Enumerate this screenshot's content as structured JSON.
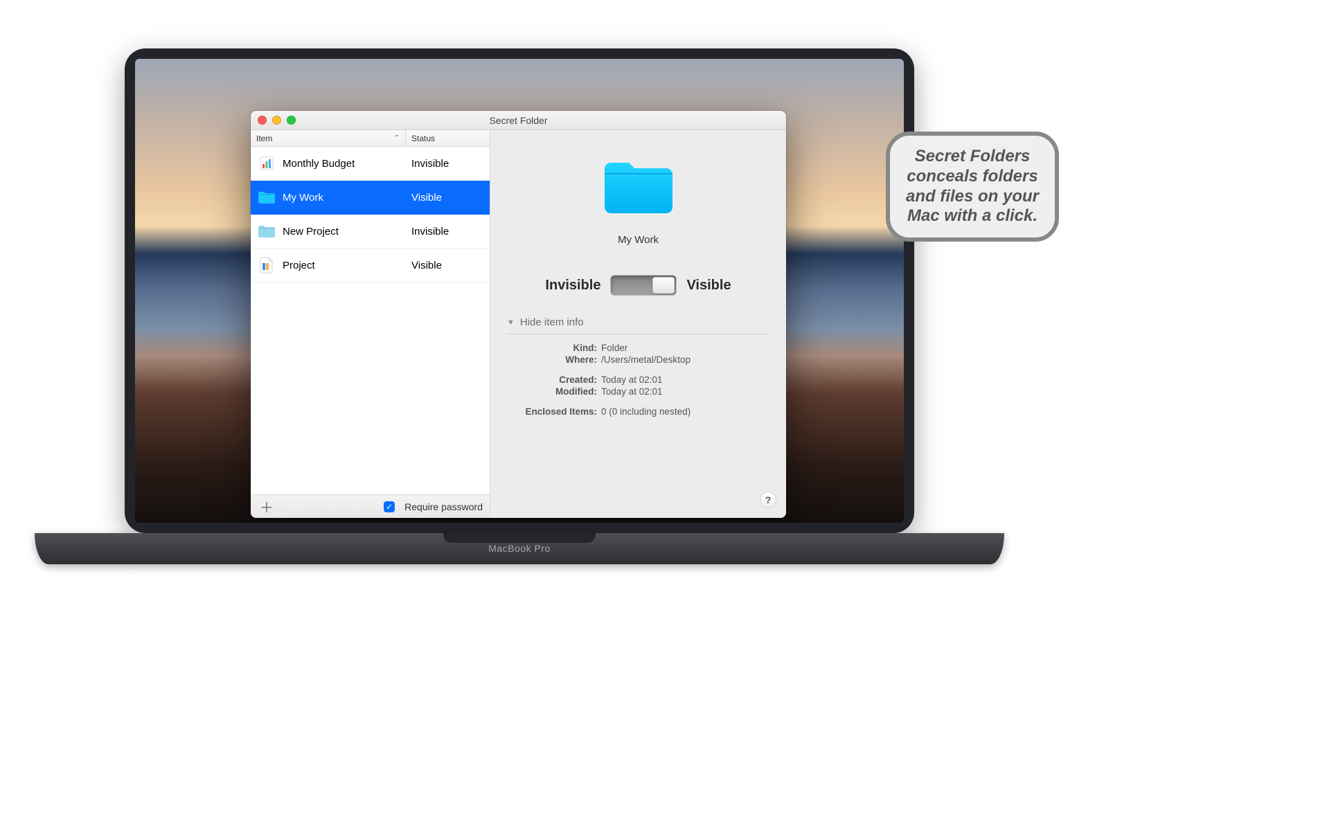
{
  "callout": {
    "text": "Secret Folders conceals folders and files on your Mac with a click."
  },
  "laptop": {
    "label": "MacBook Pro"
  },
  "window": {
    "title": "Secret Folder",
    "columns": {
      "item": "Item",
      "status": "Status"
    },
    "items": [
      {
        "icon": "chart",
        "name": "Monthly Budget",
        "status": "Invisible",
        "selected": false
      },
      {
        "icon": "folder",
        "name": "My Work",
        "status": "Visible",
        "selected": true
      },
      {
        "icon": "folder",
        "name": "New Project",
        "status": "Invisible",
        "selected": false
      },
      {
        "icon": "doc",
        "name": "Project",
        "status": "Visible",
        "selected": false
      }
    ],
    "footer": {
      "require_password_label": "Require password",
      "require_password_checked": true
    },
    "detail": {
      "preview_name": "My Work",
      "toggle": {
        "left": "Invisible",
        "right": "Visible",
        "state": "Visible"
      },
      "disclosure_label": "Hide item info",
      "info": {
        "kind_label": "Kind:",
        "kind_value": "Folder",
        "where_label": "Where:",
        "where_value": "/Users/metal/Desktop",
        "created_label": "Created:",
        "created_value": "Today at 02:01",
        "modified_label": "Modified:",
        "modified_value": "Today at 02:01",
        "enclosed_label": "Enclosed Items:",
        "enclosed_value": "0 (0 including nested)"
      },
      "help_label": "?"
    }
  }
}
